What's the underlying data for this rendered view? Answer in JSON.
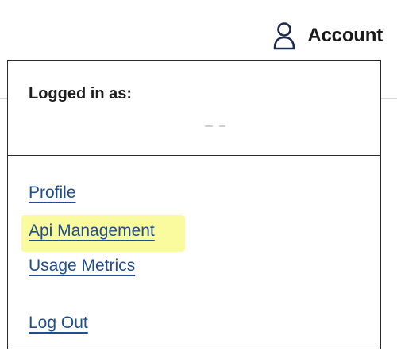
{
  "header": {
    "account_label": "Account",
    "account_icon": "user-icon"
  },
  "dropdown": {
    "logged_in_label": "Logged in as:",
    "menu": {
      "profile": "Profile",
      "api_management": "Api Management",
      "usage_metrics": "Usage Metrics",
      "log_out": "Log Out"
    },
    "highlighted_item": "Api Management"
  },
  "colors": {
    "link": "#1f4e8a",
    "highlight": "#fafa9e",
    "border": "#2b2b2b",
    "icon": "#1c2b4a"
  }
}
